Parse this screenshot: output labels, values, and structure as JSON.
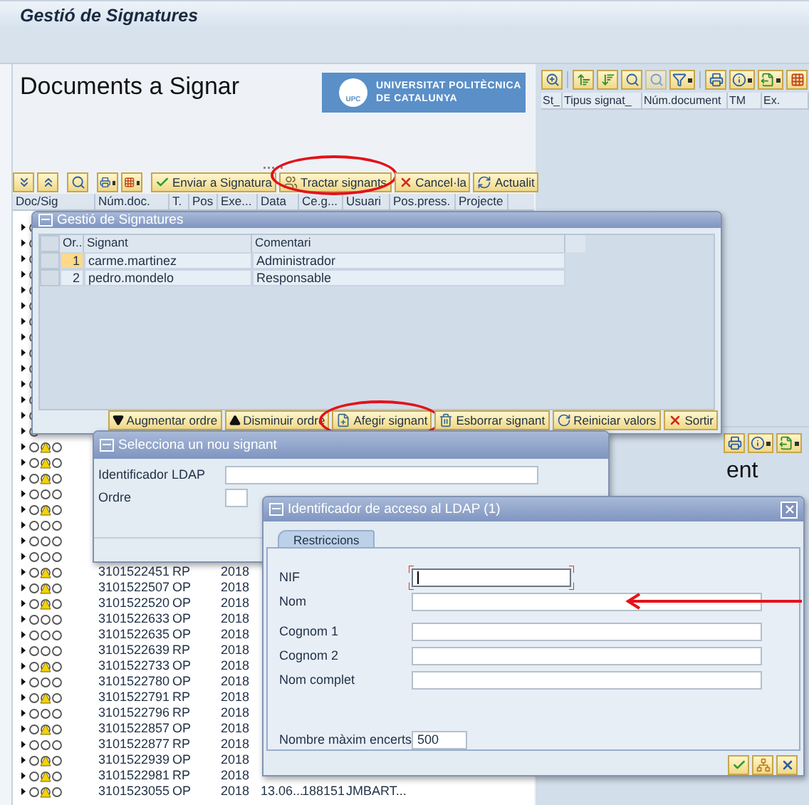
{
  "window": {
    "title": "Gestió de Signatures"
  },
  "left_pane": {
    "heading": "Documents a Signar",
    "logo": {
      "badge": "UPC",
      "line_1": "UNIVERSITAT POLITÈCNICA",
      "line_2": "DE CATALUNYA"
    },
    "toolbar_buttons": [
      {
        "label": "Enviar a Signatura",
        "highlighted": false
      },
      {
        "label": "Tractar signants",
        "highlighted": true
      },
      {
        "label": "Cancel·la",
        "highlighted": false
      },
      {
        "label": "Actualit",
        "highlighted": false
      }
    ],
    "columns": [
      "Doc/Sig",
      "Núm.doc.",
      "T.",
      "Pos",
      "Exe...",
      "Data",
      "Ce.g...",
      "Usuari",
      "Pos.press.",
      "Projecte"
    ],
    "rows": [
      {
        "kind": "covered"
      },
      {
        "kind": "covered"
      },
      {
        "kind": "covered"
      },
      {
        "kind": "covered"
      },
      {
        "kind": "covered"
      },
      {
        "kind": "covered"
      },
      {
        "kind": "covered"
      },
      {
        "kind": "covered"
      },
      {
        "kind": "covered"
      },
      {
        "kind": "covered"
      },
      {
        "kind": "covered"
      },
      {
        "kind": "covered"
      },
      {
        "kind": "covered"
      },
      {
        "kind": "covered"
      },
      {
        "kind": "item",
        "warning": true
      },
      {
        "kind": "item",
        "warning": true
      },
      {
        "kind": "item",
        "warning": true
      },
      {
        "kind": "item",
        "warning": false
      },
      {
        "kind": "item",
        "warning": true
      },
      {
        "kind": "item",
        "warning": false
      },
      {
        "kind": "item",
        "warning": false
      },
      {
        "kind": "item",
        "warning": false
      },
      {
        "kind": "item",
        "warning": true,
        "cells": [
          "",
          "3101522451",
          "RP",
          "",
          "2018"
        ]
      },
      {
        "kind": "item",
        "warning": true,
        "cells": [
          "",
          "3101522507",
          "OP",
          "",
          "2018"
        ]
      },
      {
        "kind": "item",
        "warning": true,
        "cells": [
          "",
          "3101522520",
          "OP",
          "",
          "2018"
        ]
      },
      {
        "kind": "item",
        "warning": false,
        "cells": [
          "",
          "3101522633",
          "OP",
          "",
          "2018"
        ]
      },
      {
        "kind": "item",
        "warning": false,
        "cells": [
          "",
          "3101522635",
          "OP",
          "",
          "2018"
        ]
      },
      {
        "kind": "item",
        "warning": false,
        "cells": [
          "",
          "3101522639",
          "RP",
          "",
          "2018"
        ]
      },
      {
        "kind": "item",
        "warning": true,
        "cells": [
          "",
          "3101522733",
          "OP",
          "",
          "2018"
        ]
      },
      {
        "kind": "item",
        "warning": false,
        "cells": [
          "",
          "3101522780",
          "OP",
          "",
          "2018"
        ]
      },
      {
        "kind": "item",
        "warning": true,
        "cells": [
          "",
          "3101522791",
          "RP",
          "",
          "2018"
        ]
      },
      {
        "kind": "item",
        "warning": false,
        "cells": [
          "",
          "3101522796",
          "RP",
          "",
          "2018"
        ]
      },
      {
        "kind": "item",
        "warning": true,
        "cells": [
          "",
          "3101522857",
          "OP",
          "",
          "2018"
        ]
      },
      {
        "kind": "item",
        "warning": false,
        "cells": [
          "",
          "3101522877",
          "RP",
          "",
          "2018"
        ]
      },
      {
        "kind": "item",
        "warning": true,
        "cells": [
          "",
          "3101522939",
          "OP",
          "",
          "2018"
        ]
      },
      {
        "kind": "item",
        "warning": true,
        "cells": [
          "",
          "3101522981",
          "RP",
          "",
          "2018"
        ]
      },
      {
        "kind": "item",
        "warning": true,
        "cells": [
          "",
          "3101523055",
          "OP",
          "",
          "2018",
          "13.06...",
          "188151",
          "JMBART..."
        ]
      }
    ]
  },
  "right_pane": {
    "columns": [
      "St_",
      "Tipus signat_",
      "Núm.document",
      "TM",
      "Ex."
    ],
    "lower_heading": "ent"
  },
  "signatures_dialog": {
    "title": "Gestió de Signatures",
    "columns": [
      "Or..",
      "Signant",
      "Comentari"
    ],
    "rows": [
      {
        "order": "1",
        "signant": "carme.martinez",
        "comentari": "Administrador",
        "selected": true
      },
      {
        "order": "2",
        "signant": "pedro.mondelo",
        "comentari": "Responsable",
        "selected": false
      }
    ],
    "buttons": [
      {
        "label": "Augmentar ordre",
        "highlighted": false
      },
      {
        "label": "Disminuir ordre",
        "highlighted": false
      },
      {
        "label": "Afegir signant",
        "highlighted": true
      },
      {
        "label": "Esborrar signant",
        "highlighted": false
      },
      {
        "label": "Reiniciar valors",
        "highlighted": false
      },
      {
        "label": "Sortir",
        "highlighted": false
      }
    ]
  },
  "new_signer_dialog": {
    "title": "Selecciona un nou signant",
    "fields": [
      {
        "label": "Identificador LDAP",
        "kind": "long"
      },
      {
        "label": "Ordre",
        "kind": "short"
      }
    ]
  },
  "ldap_dialog": {
    "title": "Identificador de acceso al LDAP (1)",
    "tab": {
      "label": "Restriccions",
      "selected": true
    },
    "fields": [
      {
        "label": "NIF",
        "kind": "medium",
        "focused": true,
        "pointed": false
      },
      {
        "label": "Nom",
        "kind": "long",
        "focused": false,
        "pointed": true
      },
      {
        "label": "Cognom 1",
        "kind": "long",
        "focused": false,
        "pointed": false
      },
      {
        "label": "Cognom 2",
        "kind": "long",
        "focused": false,
        "pointed": false
      },
      {
        "label": "Nom complet",
        "kind": "long",
        "focused": false,
        "pointed": false
      },
      {
        "label": "Nombre màxim encerts",
        "kind": "short",
        "focused": false,
        "pointed": false,
        "value": "500"
      }
    ]
  }
}
